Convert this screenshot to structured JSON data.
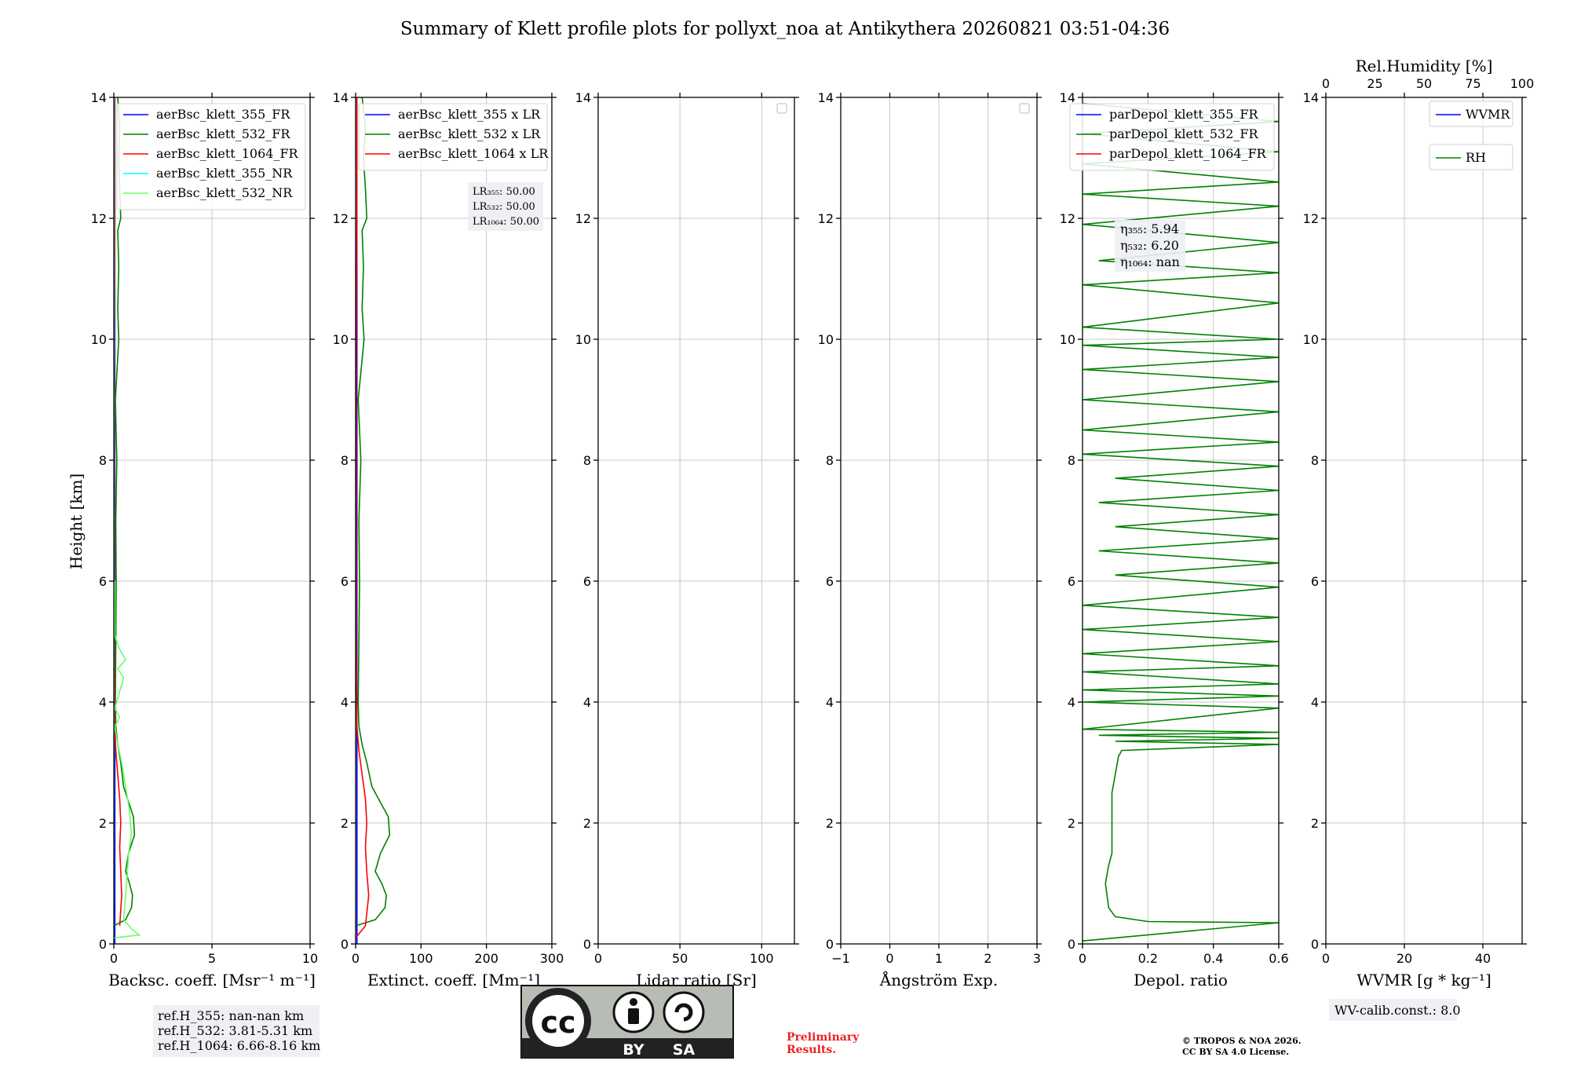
{
  "figure_title": "Summary of Klett profile plots for pollyxt_noa at Antikythera 20260821 03:51-04:36",
  "y_label": "Height [km]",
  "colors": {
    "blue": "#0000ff",
    "green": "#008000",
    "red": "#ff0000",
    "cyan": "#00ffff",
    "lightgreen": "#66ff66"
  },
  "chart_data": [
    {
      "type": "line",
      "xlabel": "Backsc. coeff. [Msr⁻¹ m⁻¹]",
      "xlim": [
        0,
        10
      ],
      "ylim": [
        0,
        14
      ],
      "x_ticks": [
        0,
        5,
        10
      ],
      "y_ticks": [
        0,
        2,
        4,
        6,
        8,
        10,
        12,
        14
      ],
      "grid": true,
      "legend_loc": "top-right",
      "series": [
        {
          "name": "aerBsc_klett_355_FR",
          "color": "#0000ff",
          "points": [
            [
              0.05,
              0.0
            ],
            [
              0.05,
              14.0
            ]
          ]
        },
        {
          "name": "aerBsc_klett_532_FR",
          "color": "#008000",
          "points": [
            [
              0.0,
              0.3
            ],
            [
              0.6,
              0.4
            ],
            [
              0.9,
              0.6
            ],
            [
              0.95,
              0.8
            ],
            [
              0.8,
              1.0
            ],
            [
              0.6,
              1.2
            ],
            [
              0.75,
              1.5
            ],
            [
              1.05,
              1.8
            ],
            [
              1.0,
              2.1
            ],
            [
              0.8,
              2.3
            ],
            [
              0.5,
              2.6
            ],
            [
              0.35,
              3.0
            ],
            [
              0.2,
              3.3
            ],
            [
              0.1,
              3.6
            ],
            [
              0.08,
              4.0
            ],
            [
              0.1,
              5.0
            ],
            [
              0.12,
              6.0
            ],
            [
              0.1,
              7.0
            ],
            [
              0.15,
              8.0
            ],
            [
              0.08,
              9.0
            ],
            [
              0.25,
              10.0
            ],
            [
              0.2,
              10.5
            ],
            [
              0.25,
              11.2
            ],
            [
              0.2,
              11.8
            ],
            [
              0.35,
              12.0
            ],
            [
              0.3,
              12.5
            ],
            [
              0.25,
              13.0
            ],
            [
              0.3,
              13.5
            ],
            [
              0.2,
              14.0
            ]
          ]
        },
        {
          "name": "aerBsc_klett_1064_FR",
          "color": "#ff0000",
          "points": [
            [
              0.3,
              0.3
            ],
            [
              0.4,
              0.8
            ],
            [
              0.35,
              1.2
            ],
            [
              0.3,
              1.6
            ],
            [
              0.35,
              2.0
            ],
            [
              0.3,
              2.4
            ],
            [
              0.2,
              2.8
            ],
            [
              0.1,
              3.2
            ],
            [
              0.05,
              3.6
            ],
            [
              0.03,
              5.0
            ],
            [
              0.03,
              8.0
            ],
            [
              0.03,
              10.0
            ],
            [
              0.05,
              12.0
            ],
            [
              0.05,
              14.0
            ]
          ]
        },
        {
          "name": "aerBsc_klett_355_NR",
          "color": "#00ffff",
          "points": [
            [
              0.0,
              0.0
            ],
            [
              0.02,
              14.0
            ]
          ]
        },
        {
          "name": "aerBsc_klett_532_NR",
          "color": "#66ff66",
          "points": [
            [
              0.0,
              0.1
            ],
            [
              1.3,
              0.15
            ],
            [
              0.9,
              0.25
            ],
            [
              0.5,
              0.4
            ],
            [
              0.6,
              0.8
            ],
            [
              0.7,
              1.2
            ],
            [
              0.75,
              1.5
            ],
            [
              0.9,
              1.8
            ],
            [
              0.8,
              2.2
            ],
            [
              0.6,
              2.6
            ],
            [
              0.4,
              3.0
            ],
            [
              0.2,
              3.3
            ],
            [
              0.05,
              3.6
            ],
            [
              0.3,
              3.75
            ],
            [
              0.05,
              3.9
            ],
            [
              0.5,
              4.4
            ],
            [
              0.2,
              4.55
            ],
            [
              0.6,
              4.7
            ],
            [
              0.25,
              4.9
            ],
            [
              0.05,
              5.1
            ],
            [
              0.05,
              6.0
            ]
          ]
        }
      ],
      "info_box": [
        "ref.H_355: nan-nan km",
        "ref.H_532: 3.81-5.31 km",
        "ref.H_1064: 6.66-8.16 km"
      ]
    },
    {
      "type": "line",
      "xlabel": "Extinct. coeff. [Mm⁻¹]",
      "xlim": [
        0,
        300
      ],
      "ylim": [
        0,
        14
      ],
      "x_ticks": [
        0,
        100,
        200,
        300
      ],
      "y_ticks": [
        0,
        2,
        4,
        6,
        8,
        10,
        12,
        14
      ],
      "grid": true,
      "legend_loc": "top-right",
      "series": [
        {
          "name": "aerBsc_klett_355 x LR",
          "color": "#0000ff",
          "points": [
            [
              2,
              0.0
            ],
            [
              2,
              14.0
            ]
          ]
        },
        {
          "name": "aerBsc_klett_532 x LR",
          "color": "#008000",
          "points": [
            [
              0,
              0.3
            ],
            [
              30,
              0.4
            ],
            [
              45,
              0.6
            ],
            [
              47,
              0.8
            ],
            [
              40,
              1.0
            ],
            [
              30,
              1.2
            ],
            [
              38,
              1.5
            ],
            [
              52,
              1.8
            ],
            [
              50,
              2.1
            ],
            [
              40,
              2.3
            ],
            [
              25,
              2.6
            ],
            [
              17,
              3.0
            ],
            [
              10,
              3.3
            ],
            [
              5,
              3.6
            ],
            [
              4,
              4.0
            ],
            [
              5,
              5.0
            ],
            [
              6,
              6.0
            ],
            [
              5,
              7.0
            ],
            [
              8,
              8.0
            ],
            [
              4,
              9.0
            ],
            [
              13,
              10.0
            ],
            [
              10,
              10.5
            ],
            [
              12,
              11.2
            ],
            [
              10,
              11.8
            ],
            [
              17,
              12.0
            ],
            [
              15,
              12.5
            ],
            [
              12,
              13.0
            ],
            [
              15,
              13.5
            ],
            [
              10,
              14.0
            ]
          ]
        },
        {
          "name": "aerBsc_klett_1064 x LR",
          "color": "#ff0000",
          "points": [
            [
              0,
              0.1
            ],
            [
              15,
              0.3
            ],
            [
              20,
              0.8
            ],
            [
              17,
              1.2
            ],
            [
              15,
              1.6
            ],
            [
              17,
              2.0
            ],
            [
              15,
              2.4
            ],
            [
              10,
              2.8
            ],
            [
              5,
              3.2
            ],
            [
              2,
              3.6
            ],
            [
              1,
              5.0
            ],
            [
              1,
              8.0
            ],
            [
              1,
              10.0
            ],
            [
              2,
              12.0
            ],
            [
              2,
              14.0
            ]
          ]
        }
      ],
      "info_box": [
        "LR₃₅₅: 50.00",
        "LR₅₃₂: 50.00",
        "LR₁₀₆₄: 50.00"
      ]
    },
    {
      "type": "line",
      "xlabel": "Lidar ratio [Sr]",
      "xlim": [
        0,
        120
      ],
      "ylim": [
        0,
        14
      ],
      "x_ticks": [
        0,
        50,
        100
      ],
      "y_ticks": [
        0,
        2,
        4,
        6,
        8,
        10,
        12,
        14
      ],
      "grid": true,
      "legend_loc": "top-right",
      "series": []
    },
    {
      "type": "line",
      "xlabel": "Ångström Exp.",
      "xlim": [
        -1,
        3
      ],
      "ylim": [
        0,
        14
      ],
      "x_ticks": [
        -1,
        0,
        1,
        2,
        3
      ],
      "y_ticks": [
        0,
        2,
        4,
        6,
        8,
        10,
        12,
        14
      ],
      "grid": true,
      "legend_loc": "top-right",
      "series": []
    },
    {
      "type": "line",
      "xlabel": "Depol. ratio",
      "xlim": [
        0,
        0.6
      ],
      "ylim": [
        0,
        14
      ],
      "x_ticks": [
        0.0,
        0.2,
        0.4,
        0.6
      ],
      "y_ticks": [
        0,
        2,
        4,
        6,
        8,
        10,
        12,
        14
      ],
      "grid": true,
      "legend_loc": "top-right",
      "series": [
        {
          "name": "parDepol_klett_355_FR",
          "color": "#0000ff",
          "points": []
        },
        {
          "name": "parDepol_klett_532_FR",
          "color": "#008000",
          "points": [
            [
              0.0,
              0.05
            ],
            [
              0.6,
              0.35
            ],
            [
              0.2,
              0.37
            ],
            [
              0.1,
              0.45
            ],
            [
              0.08,
              0.6
            ],
            [
              0.07,
              1.0
            ],
            [
              0.08,
              1.3
            ],
            [
              0.09,
              1.5
            ],
            [
              0.09,
              2.0
            ],
            [
              0.09,
              2.5
            ],
            [
              0.1,
              2.8
            ],
            [
              0.11,
              3.1
            ],
            [
              0.12,
              3.2
            ],
            [
              0.6,
              3.3
            ],
            [
              0.1,
              3.35
            ],
            [
              0.6,
              3.4
            ],
            [
              0.05,
              3.45
            ],
            [
              0.6,
              3.5
            ],
            [
              0.0,
              3.55
            ],
            [
              0.6,
              3.9
            ],
            [
              0.0,
              4.0
            ],
            [
              0.6,
              4.1
            ],
            [
              0.0,
              4.2
            ],
            [
              0.6,
              4.3
            ],
            [
              0.0,
              4.5
            ],
            [
              0.6,
              4.6
            ],
            [
              0.0,
              4.8
            ],
            [
              0.6,
              5.0
            ],
            [
              0.0,
              5.2
            ],
            [
              0.6,
              5.4
            ],
            [
              0.0,
              5.6
            ],
            [
              0.6,
              5.9
            ],
            [
              0.1,
              6.1
            ],
            [
              0.6,
              6.3
            ],
            [
              0.05,
              6.5
            ],
            [
              0.6,
              6.7
            ],
            [
              0.1,
              6.9
            ],
            [
              0.6,
              7.1
            ],
            [
              0.05,
              7.3
            ],
            [
              0.6,
              7.5
            ],
            [
              0.1,
              7.7
            ],
            [
              0.6,
              7.9
            ],
            [
              0.0,
              8.1
            ],
            [
              0.6,
              8.3
            ],
            [
              0.0,
              8.5
            ],
            [
              0.6,
              8.8
            ],
            [
              0.0,
              9.0
            ],
            [
              0.6,
              9.3
            ],
            [
              0.0,
              9.5
            ],
            [
              0.6,
              9.7
            ],
            [
              0.0,
              9.9
            ],
            [
              0.6,
              10.0
            ],
            [
              0.0,
              10.2
            ],
            [
              0.6,
              10.6
            ],
            [
              0.0,
              10.9
            ],
            [
              0.6,
              11.1
            ],
            [
              0.05,
              11.3
            ],
            [
              0.6,
              11.6
            ],
            [
              0.0,
              11.9
            ],
            [
              0.6,
              12.2
            ],
            [
              0.0,
              12.4
            ],
            [
              0.6,
              12.6
            ],
            [
              0.0,
              12.9
            ],
            [
              0.6,
              13.1
            ],
            [
              0.0,
              13.4
            ],
            [
              0.6,
              13.6
            ],
            [
              0.0,
              13.9
            ]
          ]
        },
        {
          "name": "parDepol_klett_1064_FR",
          "color": "#ff0000",
          "points": []
        }
      ],
      "info_box": [
        "η₃₅₅: 5.94",
        "η₅₃₂: 6.20",
        "η₁₀₆₄: nan"
      ]
    },
    {
      "type": "line",
      "xlabel": "WVMR [g * kg⁻¹]",
      "top_xlabel": "Rel.Humidity [%]",
      "xlim": [
        0,
        50
      ],
      "top_xlim": [
        0,
        100
      ],
      "ylim": [
        0,
        14
      ],
      "x_ticks": [
        0,
        20,
        40
      ],
      "top_x_ticks": [
        0,
        25,
        50,
        75,
        100
      ],
      "y_ticks": [
        0,
        2,
        4,
        6,
        8,
        10,
        12,
        14
      ],
      "grid": true,
      "legend_loc": "top-right",
      "series": [
        {
          "name": "WVMR",
          "color": "#0000ff",
          "points": []
        },
        {
          "name": "RH",
          "color": "#008000",
          "points": []
        }
      ],
      "info_box": [
        "WV-calib.const.: 8.0"
      ]
    }
  ],
  "footer": {
    "cc_by": "BY",
    "cc_sa": "SA",
    "prelim": [
      "Preliminary",
      "Results."
    ],
    "copyright": [
      "© TROPOS & NOA 2026.",
      "CC BY SA 4.0 License."
    ]
  }
}
